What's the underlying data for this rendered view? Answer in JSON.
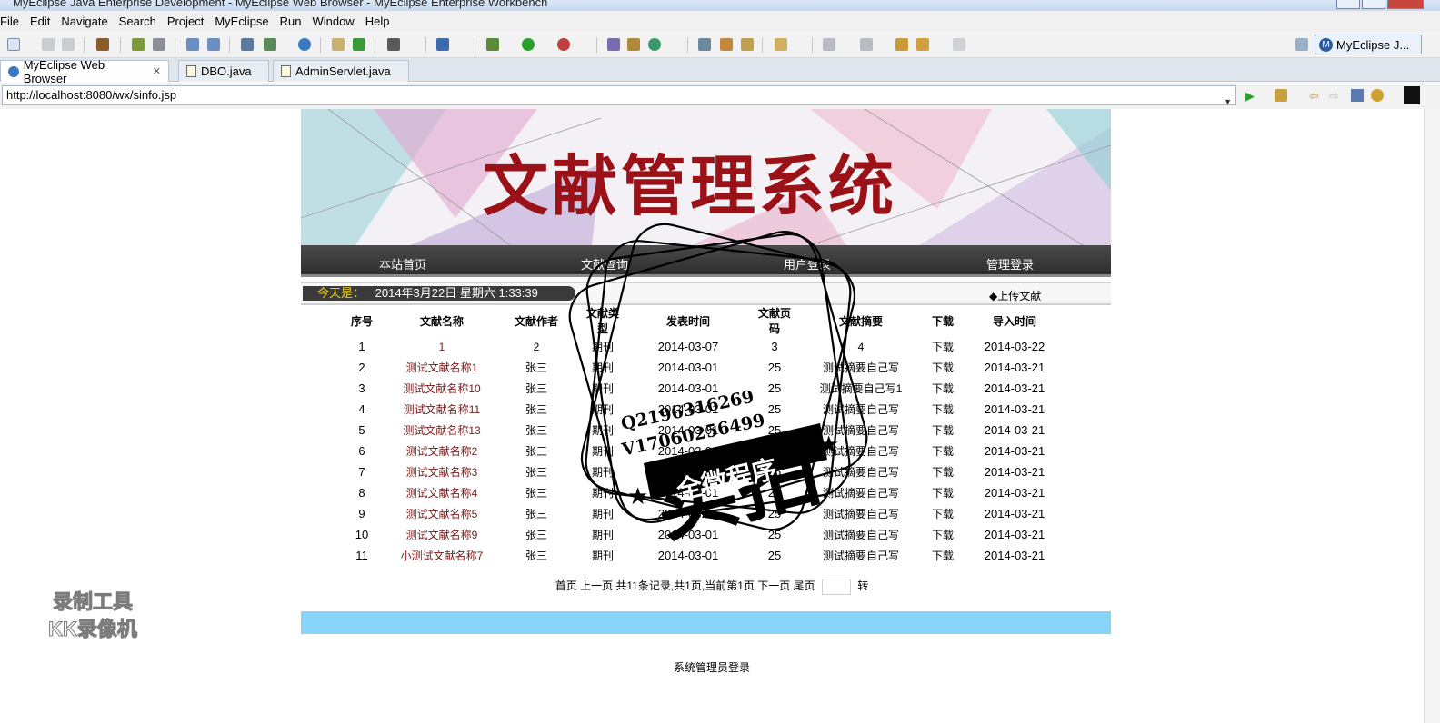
{
  "window": {
    "title": "MyEclipse Java Enterprise Development - MyEclipse Web Browser - MyEclipse Enterprise Workbench"
  },
  "menu": [
    "File",
    "Edit",
    "Navigate",
    "Search",
    "Project",
    "MyEclipse",
    "Run",
    "Window",
    "Help"
  ],
  "perspective": {
    "label": "MyEclipse J...",
    "badge": "M"
  },
  "tabs": [
    {
      "label": "MyEclipse Web Browser",
      "close": "✕"
    },
    {
      "label": "DBO.java"
    },
    {
      "label": "AdminServlet.java"
    }
  ],
  "address": {
    "url": "http://localhost:8080/wx/sinfo.jsp"
  },
  "site": {
    "banner_title": "文献管理系统",
    "nav": [
      "本站首页",
      "文献查询",
      "用户登录",
      "管理登录"
    ],
    "date_label": "今天是：",
    "date_value": "2014年3月22日 星期六 1:33:39",
    "upload": "◆上传文献"
  },
  "table": {
    "headers": [
      "序号",
      "文献名称",
      "文献作者",
      "文献类型",
      "发表时间",
      "文献页码",
      "文献摘要",
      "下载",
      "导入时间"
    ],
    "rows": [
      [
        "1",
        "1",
        "2",
        "期刊",
        "2014-03-07",
        "3",
        "4",
        "下载",
        "2014-03-22"
      ],
      [
        "2",
        "测试文献名称1",
        "张三",
        "期刊",
        "2014-03-01",
        "25",
        "测试摘要自己写",
        "下载",
        "2014-03-21"
      ],
      [
        "3",
        "测试文献名称10",
        "张三",
        "期刊",
        "2014-03-01",
        "25",
        "测试摘要自己写1",
        "下载",
        "2014-03-21"
      ],
      [
        "4",
        "测试文献名称11",
        "张三",
        "期刊",
        "2014-03-01",
        "25",
        "测试摘要自己写",
        "下载",
        "2014-03-21"
      ],
      [
        "5",
        "测试文献名称13",
        "张三",
        "期刊",
        "2014-03-01",
        "25",
        "测试摘要自己写",
        "下载",
        "2014-03-21"
      ],
      [
        "6",
        "测试文献名称2",
        "张三",
        "期刊",
        "2014-03-01",
        "25",
        "测试摘要自己写",
        "下载",
        "2014-03-21"
      ],
      [
        "7",
        "测试文献名称3",
        "张三",
        "期刊",
        "2014-03-01",
        "25",
        "测试摘要自己写",
        "下载",
        "2014-03-21"
      ],
      [
        "8",
        "测试文献名称4",
        "张三",
        "期刊",
        "2014-03-01",
        "25",
        "测试摘要自己写",
        "下载",
        "2014-03-21"
      ],
      [
        "9",
        "测试文献名称5",
        "张三",
        "期刊",
        "2014-03-01",
        "25",
        "测试摘要自己写",
        "下载",
        "2014-03-21"
      ],
      [
        "10",
        "测试文献名称9",
        "张三",
        "期刊",
        "2014-03-01",
        "25",
        "测试摘要自己写",
        "下载",
        "2014-03-21"
      ],
      [
        "11",
        "小测试文献名称7",
        "张三",
        "期刊",
        "2014-03-01",
        "25",
        "测试摘要自己写",
        "下载",
        "2014-03-21"
      ]
    ]
  },
  "pager": {
    "text": "首页 上一页 共11条记录,共1页,当前第1页 下一页 尾页",
    "goto": "转"
  },
  "footer": {
    "admin_login": "系统管理员登录"
  },
  "overlay": {
    "stamp_line1": "Q2196316269",
    "stamp_line2": "V17060256499",
    "stamp_big": "实拍",
    "stamp_ribbon": "全微程序",
    "watermark_line1": "录制工具",
    "watermark_line2": "KK录像机"
  },
  "colors": {
    "nav_bg": "#333333",
    "banner_title": "#9a1218",
    "blue_bar": "#87d4f8",
    "date_label": "#f2d200"
  }
}
